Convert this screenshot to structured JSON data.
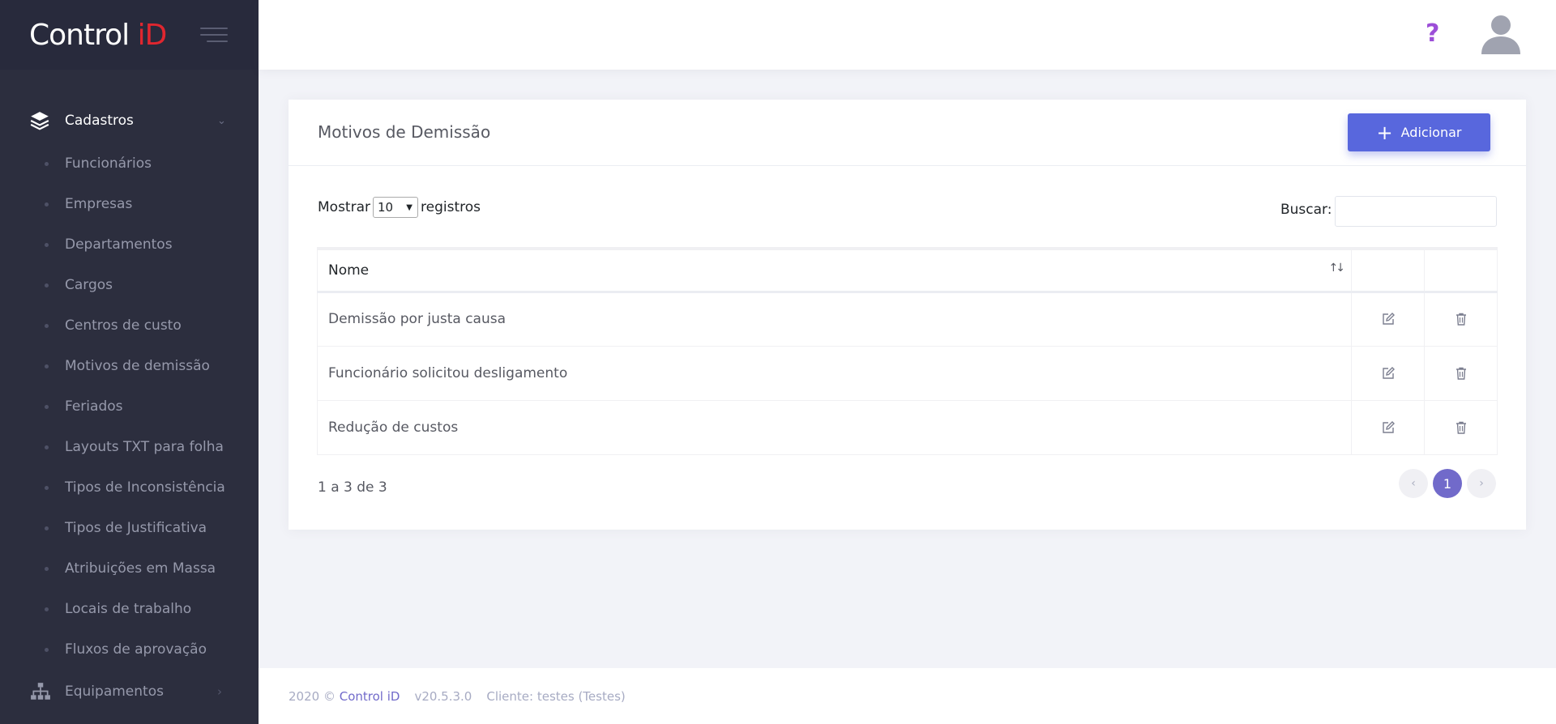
{
  "brand": {
    "logo_main": "Control ",
    "logo_accent": "iD"
  },
  "sidebar": {
    "sections": [
      {
        "label": "Cadastros",
        "icon": "layers-icon",
        "expanded": true
      },
      {
        "label": "Equipamentos",
        "icon": "sitemap-icon",
        "expanded": false
      }
    ],
    "items": [
      "Funcionários",
      "Empresas",
      "Departamentos",
      "Cargos",
      "Centros de custo",
      "Motivos de demissão",
      "Feriados",
      "Layouts TXT para folha",
      "Tipos de Inconsistência",
      "Tipos de Justificativa",
      "Atribuições em Massa",
      "Locais de trabalho",
      "Fluxos de aprovação"
    ]
  },
  "header": {
    "help_icon": "?"
  },
  "page": {
    "title": "Motivos de Demissão",
    "add_label": "Adicionar",
    "show_prefix": "Mostrar",
    "show_value": "10",
    "show_suffix": "registros",
    "search_label": "Buscar:",
    "search_value": "",
    "table": {
      "columns": [
        "Nome",
        "",
        ""
      ],
      "rows": [
        "Demissão por justa causa",
        "Funcionário solicitou desligamento",
        "Redução de custos"
      ]
    },
    "info": "1 a 3 de 3",
    "pagination": {
      "prev": "‹",
      "current": "1",
      "next": "›"
    }
  },
  "footer": {
    "copyright": "2020 ©",
    "brand_link": "Control iD",
    "version": "v20.5.3.0",
    "client": "Cliente: testes (Testes)"
  },
  "colors": {
    "sidebar": "#2c2e3e",
    "accent": "#5867dd",
    "pager_active": "#716aca",
    "brand_red": "#e0262f",
    "help": "#9c4ed8"
  }
}
